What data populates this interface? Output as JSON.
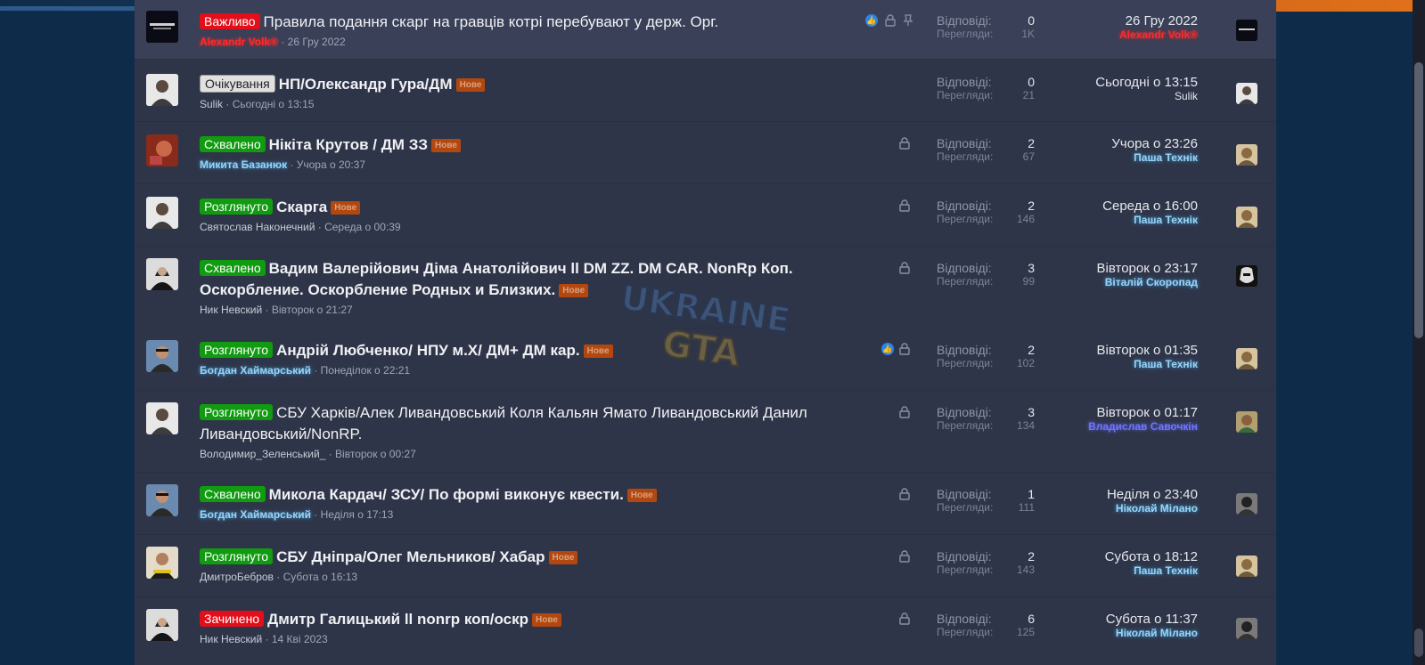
{
  "labels": {
    "replies": "Відповіді:",
    "views": "Перегляди:",
    "new_badge": "Нове"
  },
  "colors": {
    "accent": "#2a87ea",
    "prefix_red": "#e20f1b",
    "prefix_green": "#109b10",
    "new_badge": "#b2480f",
    "panel": "#2f3548",
    "page_bg": "#0f2b4a"
  },
  "watermark": {
    "line1": "UKRAINE",
    "line2": "GTA"
  },
  "threads": [
    {
      "prefix": "Важливо",
      "title": "Правила подання скарг на гравців котрі перебувают у держ. Орг.",
      "author": "Alexandr Volk",
      "author_mark": "®",
      "date": "26 Гру 2022",
      "replies": "0",
      "views": "1K",
      "last_date": "26 Гру 2022",
      "last_user": "Alexandr Volk",
      "last_mark": "®",
      "icons": [
        "like-icon",
        "lock-icon",
        "pin-icon"
      ]
    },
    {
      "prefix": "Очікування",
      "title": "НП/Олександр Гура/ДМ",
      "author": "Sulik",
      "date": "Сьогодні о 13:15",
      "replies": "0",
      "views": "21",
      "last_date": "Сьогодні о 13:15",
      "last_user": "Sulik",
      "icons": []
    },
    {
      "prefix": "Схвалено",
      "title": "Нікіта Крутов / ДМ ЗЗ",
      "author": "Микита Базанюк",
      "date": "Учора о 20:37",
      "replies": "2",
      "views": "67",
      "last_date": "Учора о 23:26",
      "last_user": "Паша Технік",
      "icons": [
        "lock-icon"
      ]
    },
    {
      "prefix": "Розглянуто",
      "title": "Скарга",
      "author": "Святослав Наконечний",
      "date": "Середа о 00:39",
      "replies": "2",
      "views": "146",
      "last_date": "Середа о 16:00",
      "last_user": "Паша Технік",
      "icons": [
        "lock-icon"
      ]
    },
    {
      "prefix": "Схвалено",
      "title": "Вадим Валерійович Діма Анатолійович ll DM ZZ. DM CAR. NonRp Коп. Оскорбление. Оскорбление Родных и Близких.",
      "author": "Ник Невский",
      "date": "Вівторок о 21:27",
      "replies": "3",
      "views": "99",
      "last_date": "Вівторок о 23:17",
      "last_user": "Віталій Скоропад",
      "icons": [
        "lock-icon"
      ]
    },
    {
      "prefix": "Розглянуто",
      "title": "Андрій Любченко/ НПУ м.Х/ ДМ+ ДМ кар.",
      "author": "Богдан Хаймарський",
      "date": "Понеділок о 22:21",
      "replies": "2",
      "views": "102",
      "last_date": "Вівторок о 01:35",
      "last_user": "Паша Технік",
      "icons": [
        "like-icon",
        "lock-icon"
      ]
    },
    {
      "prefix": "Розглянуто",
      "title": "СБУ Харків/Алек Ливандовський Коля Кальян Ямато Ливандовський Данил Ливандовський/NonRP.",
      "author": "Володимир_Зеленський_",
      "date": "Вівторок о 00:27",
      "replies": "3",
      "views": "134",
      "last_date": "Вівторок о 01:17",
      "last_user": "Владислав Савочкін",
      "icons": [
        "lock-icon"
      ]
    },
    {
      "prefix": "Схвалено",
      "title": "Микола Кардач/ ЗСУ/ По формі виконує квести.",
      "author": "Богдан Хаймарський",
      "date": "Неділя о 17:13",
      "replies": "1",
      "views": "111",
      "last_date": "Неділя о 23:40",
      "last_user": "Ніколай Мілано",
      "icons": [
        "lock-icon"
      ]
    },
    {
      "prefix": "Розглянуто",
      "title": "СБУ Дніпра/Олег Мельников/ Хабар",
      "author": "ДмитроБебров",
      "date": "Субота о 16:13",
      "replies": "2",
      "views": "143",
      "last_date": "Субота о 18:12",
      "last_user": "Паша Технік",
      "icons": [
        "lock-icon"
      ]
    },
    {
      "prefix": "Зачинено",
      "title": "Дмитр Галицький ll nonrp коп/оскр",
      "author": "Ник Невский",
      "date": "14 Кві 2023",
      "replies": "6",
      "views": "125",
      "last_date": "Субота о 11:37",
      "last_user": "Ніколай Мілано",
      "icons": [
        "lock-icon"
      ]
    }
  ]
}
